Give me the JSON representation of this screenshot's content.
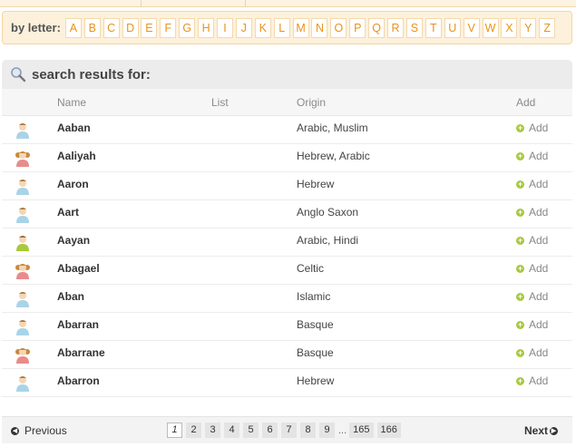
{
  "letter_bar": {
    "label": "by letter:",
    "letters": [
      "A",
      "B",
      "C",
      "D",
      "E",
      "F",
      "G",
      "H",
      "I",
      "J",
      "K",
      "L",
      "M",
      "N",
      "O",
      "P",
      "Q",
      "R",
      "S",
      "T",
      "U",
      "V",
      "W",
      "X",
      "Y",
      "Z"
    ]
  },
  "results": {
    "title": "search results for:",
    "columns": {
      "name": "Name",
      "list": "List",
      "origin": "Origin",
      "add": "Add"
    },
    "add_label": "Add",
    "rows": [
      {
        "name": "Aaban",
        "origin": "Arabic, Muslim",
        "gender": "boy"
      },
      {
        "name": "Aaliyah",
        "origin": "Hebrew, Arabic",
        "gender": "girl"
      },
      {
        "name": "Aaron",
        "origin": "Hebrew",
        "gender": "boy"
      },
      {
        "name": "Aart",
        "origin": "Anglo Saxon",
        "gender": "boy"
      },
      {
        "name": "Aayan",
        "origin": "Arabic, Hindi",
        "gender": "unisex"
      },
      {
        "name": "Abagael",
        "origin": "Celtic",
        "gender": "girl"
      },
      {
        "name": "Aban",
        "origin": "Islamic",
        "gender": "boy"
      },
      {
        "name": "Abarran",
        "origin": "Basque",
        "gender": "boy"
      },
      {
        "name": "Abarrane",
        "origin": "Basque",
        "gender": "girl"
      },
      {
        "name": "Abarron",
        "origin": "Hebrew",
        "gender": "boy"
      }
    ]
  },
  "pagination": {
    "previous": "Previous",
    "next": "Next",
    "pages": [
      "1",
      "2",
      "3",
      "4",
      "5",
      "6",
      "7",
      "8",
      "9"
    ],
    "ellipsis": "...",
    "last_pages": [
      "165",
      "166"
    ],
    "current": "1"
  },
  "colors": {
    "accent": "#e8921c",
    "letter_bar_bg": "#fdf1dc",
    "add_icon": "#a8c83c"
  }
}
